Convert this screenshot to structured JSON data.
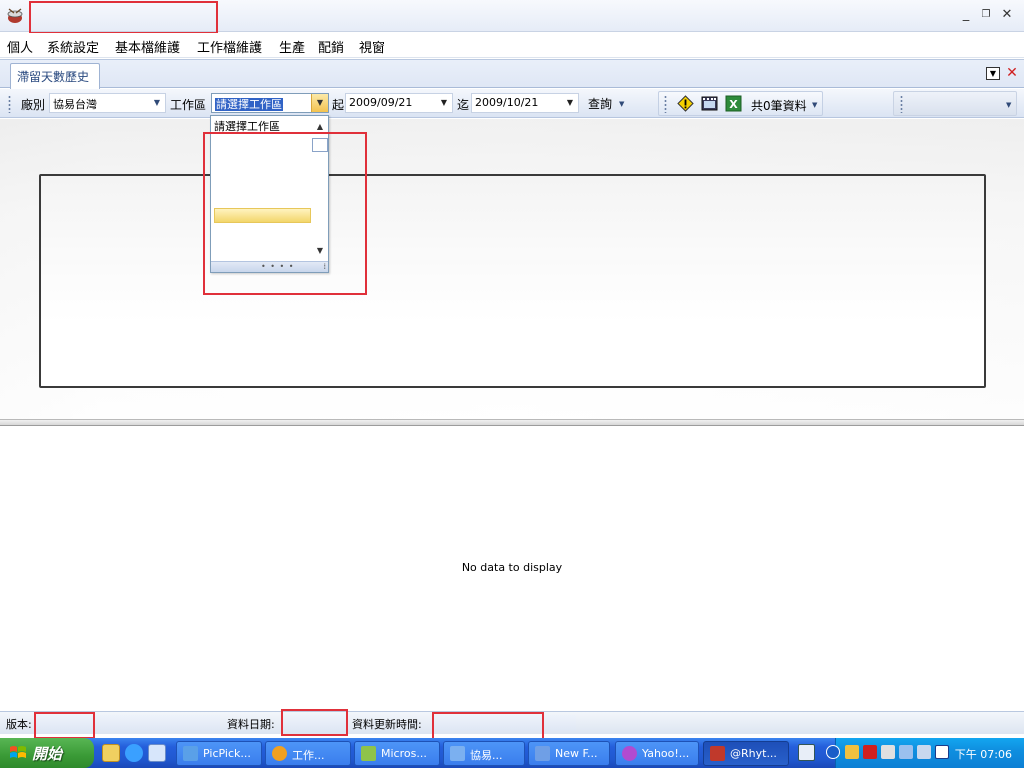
{
  "window": {
    "title": "",
    "controls": {
      "minimize": "_",
      "restore": "❐",
      "close": "✕"
    }
  },
  "menu": [
    "個人",
    "系統設定",
    "基本檔維護",
    "工作檔維護",
    "生產",
    "配銷",
    "視窗"
  ],
  "tab": {
    "label": "滯留天數歷史",
    "close": "✕",
    "dropdown": "▼"
  },
  "toolbar": {
    "factory_label": "廠別",
    "factory_value": "協易台灣",
    "workarea_label": "工作區",
    "workarea_value": "請選擇工作區",
    "from_label": "起",
    "from_date": "2009/09/21",
    "to_label": "迄",
    "to_date": "2009/10/21",
    "query_button": "查詢",
    "record_count": "共0筆資料"
  },
  "dropdown": {
    "items": [
      "請選擇工作區"
    ],
    "scroll_up": "▲",
    "scroll_down": "▼",
    "footer_grip": "• • • •",
    "footer_resize": "⁞"
  },
  "grid": {
    "empty_message": "No data to display"
  },
  "status": {
    "version_label": "版本:",
    "version_value": "",
    "data_date_label": "資料日期:",
    "data_date_value": "",
    "update_time_label": "資料更新時間:",
    "update_time_value": ""
  },
  "taskbar": {
    "start_label": "開始",
    "tasks": [
      {
        "label": "PicPick...",
        "color": "#5aa0e8"
      },
      {
        "label": "工作...",
        "color": "#f0a020"
      },
      {
        "label": "Micros...",
        "color": "#8fc34a"
      },
      {
        "label": "協易...",
        "color": "#7bb0f0"
      },
      {
        "label": "New F...",
        "color": "#6f9fe6"
      },
      {
        "label": "Yahoo!...",
        "color": "#b04bd0"
      },
      {
        "label": "@Rhyt...",
        "color": "#c0392b"
      }
    ],
    "clock": "下午 07:06"
  },
  "colors": {
    "highlight_red": "#e0303a",
    "selection_blue": "#3163c6",
    "taskbar_blue": "#245edb",
    "start_green": "#3a9a36"
  }
}
